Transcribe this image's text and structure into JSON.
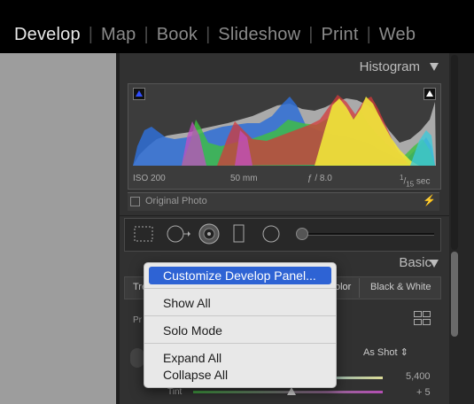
{
  "modules": [
    "Develop",
    "Map",
    "Book",
    "Slideshow",
    "Print",
    "Web"
  ],
  "histogram": {
    "title": "Histogram",
    "iso": "ISO 200",
    "focal": "50 mm",
    "aperture": "ƒ / 8.0",
    "shutter_num": "1",
    "shutter_den": "15",
    "shutter_unit": "sec",
    "original_photo": "Original Photo"
  },
  "basic": {
    "title": "Basic",
    "tr_partial": "Tre",
    "color_partial": "olor",
    "bw": "Black & White",
    "pr_partial": "Pr",
    "as_shot": "As Shot",
    "temp_value": "5,400",
    "tint_label": "Tint",
    "tint_value": "+ 5"
  },
  "menu": {
    "items": [
      {
        "label": "Customize Develop Panel...",
        "selected": true
      },
      {
        "label": "Show All"
      },
      {
        "label": "Solo Mode"
      },
      {
        "label": "Expand All"
      },
      {
        "label": "Collapse All"
      }
    ]
  },
  "colors": {
    "menu_highlight": "#2e63d4",
    "panel_bg": "#313131"
  },
  "icons": [
    "lightning-icon",
    "crop-icon",
    "spot-removal-icon",
    "red-eye-icon",
    "graduated-filter-icon",
    "radial-filter-icon",
    "adjustment-brush-icon",
    "grid-view-icon",
    "eyedropper-icon"
  ]
}
